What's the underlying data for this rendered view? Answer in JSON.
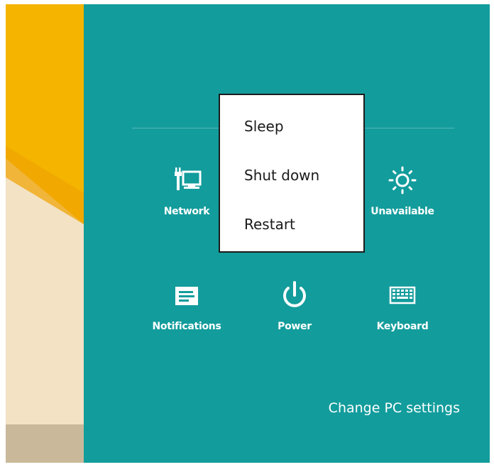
{
  "settings": {
    "tiles": {
      "network": {
        "label": "Network",
        "icon": "network-monitor-icon"
      },
      "brightness": {
        "label": "Unavailable",
        "icon": "brightness-sun-icon"
      },
      "notifications": {
        "label": "Notifications",
        "icon": "notifications-icon"
      },
      "power": {
        "label": "Power",
        "icon": "power-icon"
      },
      "keyboard": {
        "label": "Keyboard",
        "icon": "keyboard-icon"
      }
    },
    "change_pc_settings": "Change PC settings"
  },
  "power_menu": {
    "items": [
      "Sleep",
      "Shut down",
      "Restart"
    ]
  },
  "colors": {
    "panel": "#139c9c",
    "menu_bg": "#ffffff",
    "menu_border": "#1b1b1b",
    "desktop_yellow": "#f4b400",
    "desktop_cream": "#f3e2c4"
  }
}
